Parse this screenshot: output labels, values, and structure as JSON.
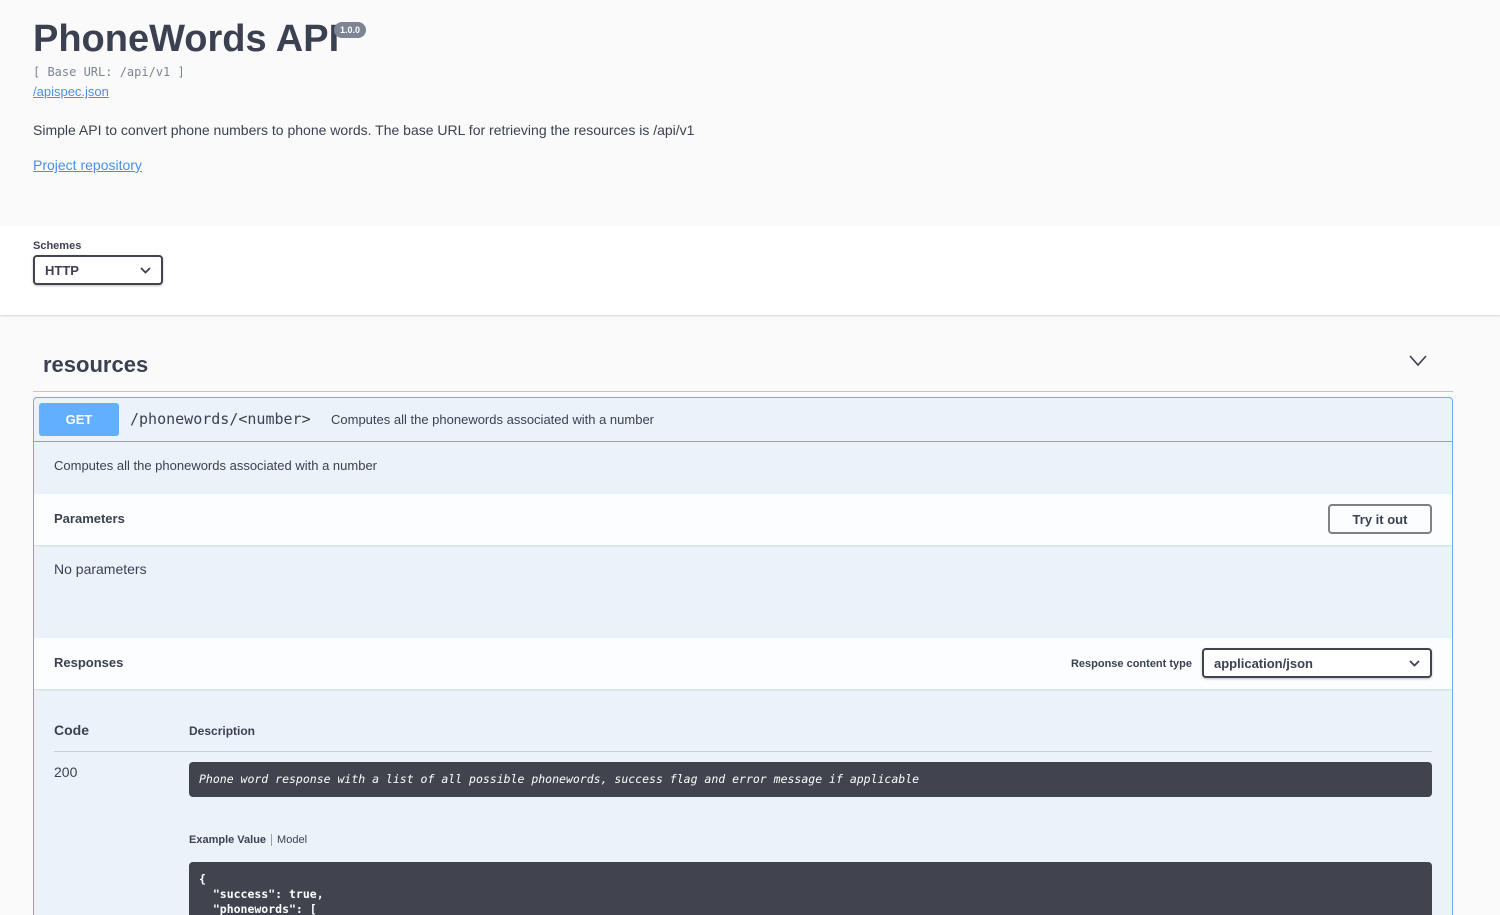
{
  "info": {
    "title": "PhoneWords API",
    "version": "1.0.0",
    "base_url": "[ Base URL: /api/v1 ]",
    "spec_link": "/apispec.json",
    "description": "Simple API to convert phone numbers to phone words. The base URL for retrieving the resources is /api/v1",
    "repo_link": "Project repository"
  },
  "schemes": {
    "label": "Schemes",
    "selected": "HTTP"
  },
  "tag": {
    "name": "resources",
    "chevron_icon": "chevron-down-icon"
  },
  "operation": {
    "method": "GET",
    "path": "/phonewords/<number>",
    "summary": "Computes all the phonewords associated with a number",
    "description": "Computes all the phonewords associated with a number",
    "method_color": "#61affe",
    "parameters": {
      "title": "Parameters",
      "try_label": "Try it out",
      "empty_text": "No parameters"
    },
    "responses": {
      "title": "Responses",
      "content_type_label": "Response content type",
      "content_type": "application/json",
      "col_code": "Code",
      "col_description": "Description",
      "rows": [
        {
          "code": "200",
          "description": "Phone word response with a list of all possible phonewords, success flag and error message if applicable"
        }
      ],
      "tab_example": "Example Value",
      "tab_model": "Model",
      "example_code": "{\n  \"success\": true,\n  \"phonewords\": ["
    }
  }
}
